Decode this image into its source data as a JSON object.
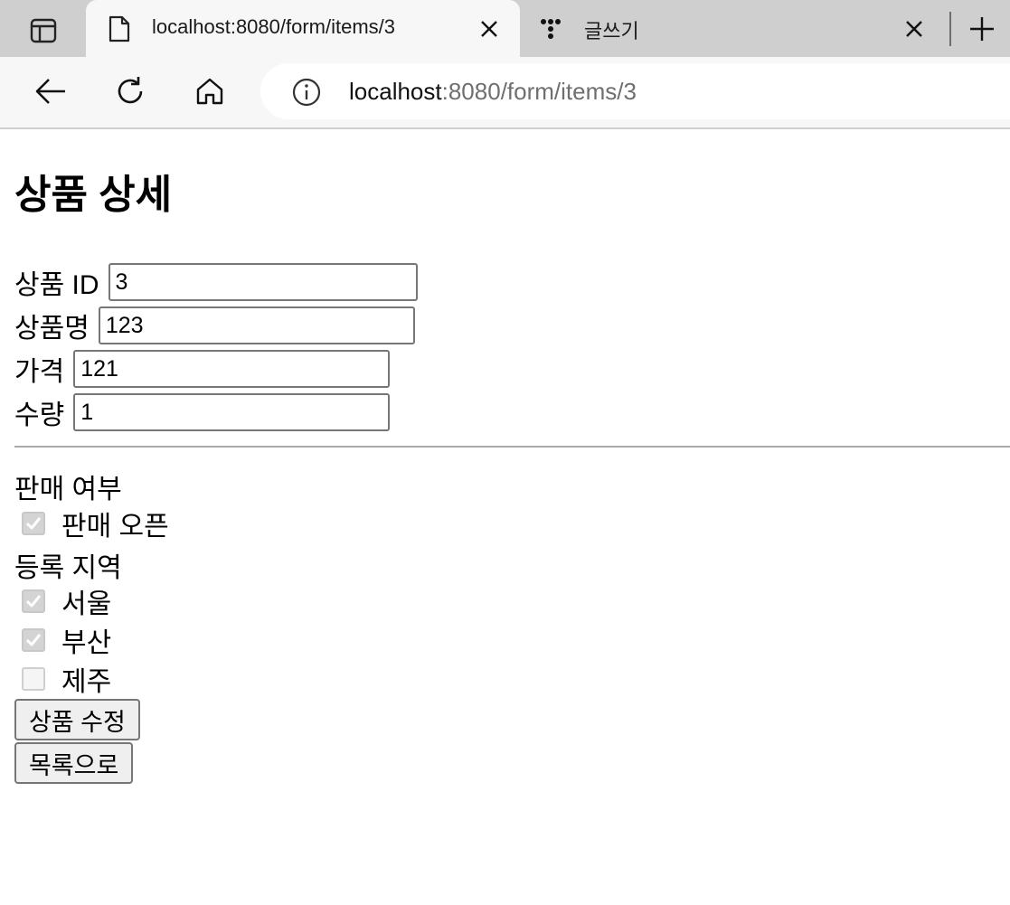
{
  "browser": {
    "tabs": [
      {
        "title": "localhost:8080/form/items/3",
        "active": true,
        "icon": "document-icon"
      },
      {
        "title": "글쓰기",
        "active": false,
        "icon": "tistory-icon"
      }
    ],
    "url": {
      "host": "localhost",
      "rest": ":8080/form/items/3"
    }
  },
  "page": {
    "title": "상품 상세",
    "fields": [
      {
        "label": "상품 ID",
        "value": "3"
      },
      {
        "label": "상품명",
        "value": "123"
      },
      {
        "label": "가격",
        "value": "121"
      },
      {
        "label": "수량",
        "value": "1"
      }
    ],
    "sale_section": {
      "label": "판매 여부",
      "option": {
        "label": "판매 오픈",
        "checked": true
      }
    },
    "region_section": {
      "label": "등록 지역",
      "options": [
        {
          "label": "서울",
          "checked": true
        },
        {
          "label": "부산",
          "checked": true
        },
        {
          "label": "제주",
          "checked": false
        }
      ]
    },
    "buttons": {
      "edit": "상품 수정",
      "list": "목록으로"
    }
  }
}
